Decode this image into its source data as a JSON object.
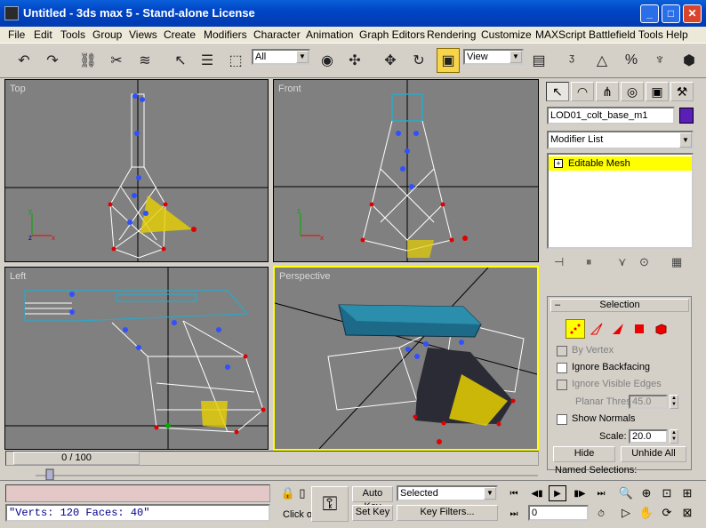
{
  "window": {
    "title": "Untitled - 3ds max 5 - Stand-alone License",
    "minimize": "_",
    "maximize": "□",
    "close": "✕"
  },
  "menu": [
    "File",
    "Edit",
    "Tools",
    "Group",
    "Views",
    "Create",
    "Modifiers",
    "Character",
    "Animation",
    "Graph Editors",
    "Rendering",
    "Customize",
    "MAXScript",
    "Battlefield Tools",
    "Help"
  ],
  "toolbar": {
    "selection_filter": "All",
    "reference_coord": "View",
    "icons": [
      "undo-icon",
      "redo-icon",
      "select-and-link-icon",
      "unlink-selection-icon",
      "bind-to-space-warp-icon",
      "select-object-icon",
      "select-by-name-icon",
      "rectangular-selection-region-icon",
      "window-crossing-icon",
      "select-and-move-icon",
      "select-and-rotate-icon",
      "select-and-scale-icon",
      "use-pivot-point-center-icon",
      "select-and-manipulate-icon",
      "snaps-toggle-icon",
      "angle-snap-icon",
      "percent-snap-icon",
      "spinner-snap-icon",
      "mirror-icon"
    ]
  },
  "viewports": {
    "top": "Top",
    "front": "Front",
    "left": "Left",
    "perspective": "Perspective"
  },
  "command_panel": {
    "object_name": "LOD01_colt_base_m1",
    "object_color": "#5c1eb8",
    "modifier_list": "Modifier List",
    "stack_item": "Editable Mesh",
    "selection": {
      "title": "Selection",
      "by_vertex": "By Vertex",
      "ignore_backfacing": "Ignore Backfacing",
      "ignore_visible_edges": "Ignore Visible Edges",
      "planar_thresh_label": "Planar Thresh:",
      "planar_thresh_value": "45.0",
      "show_normals": "Show Normals",
      "scale_label": "Scale:",
      "scale_value": "20.0",
      "hide": "Hide",
      "unhide_all": "Unhide All",
      "named_selections": "Named Selections:"
    }
  },
  "timeline": {
    "frame": "0 / 100"
  },
  "status": {
    "script_output": "\"Verts: 120 Faces: 40\"",
    "prompt": "Click o",
    "auto_key": "Auto Key",
    "set_key": "Set Key",
    "key_filter_value": "Selected",
    "key_filters": "Key Filters...",
    "current_frame": "0"
  }
}
